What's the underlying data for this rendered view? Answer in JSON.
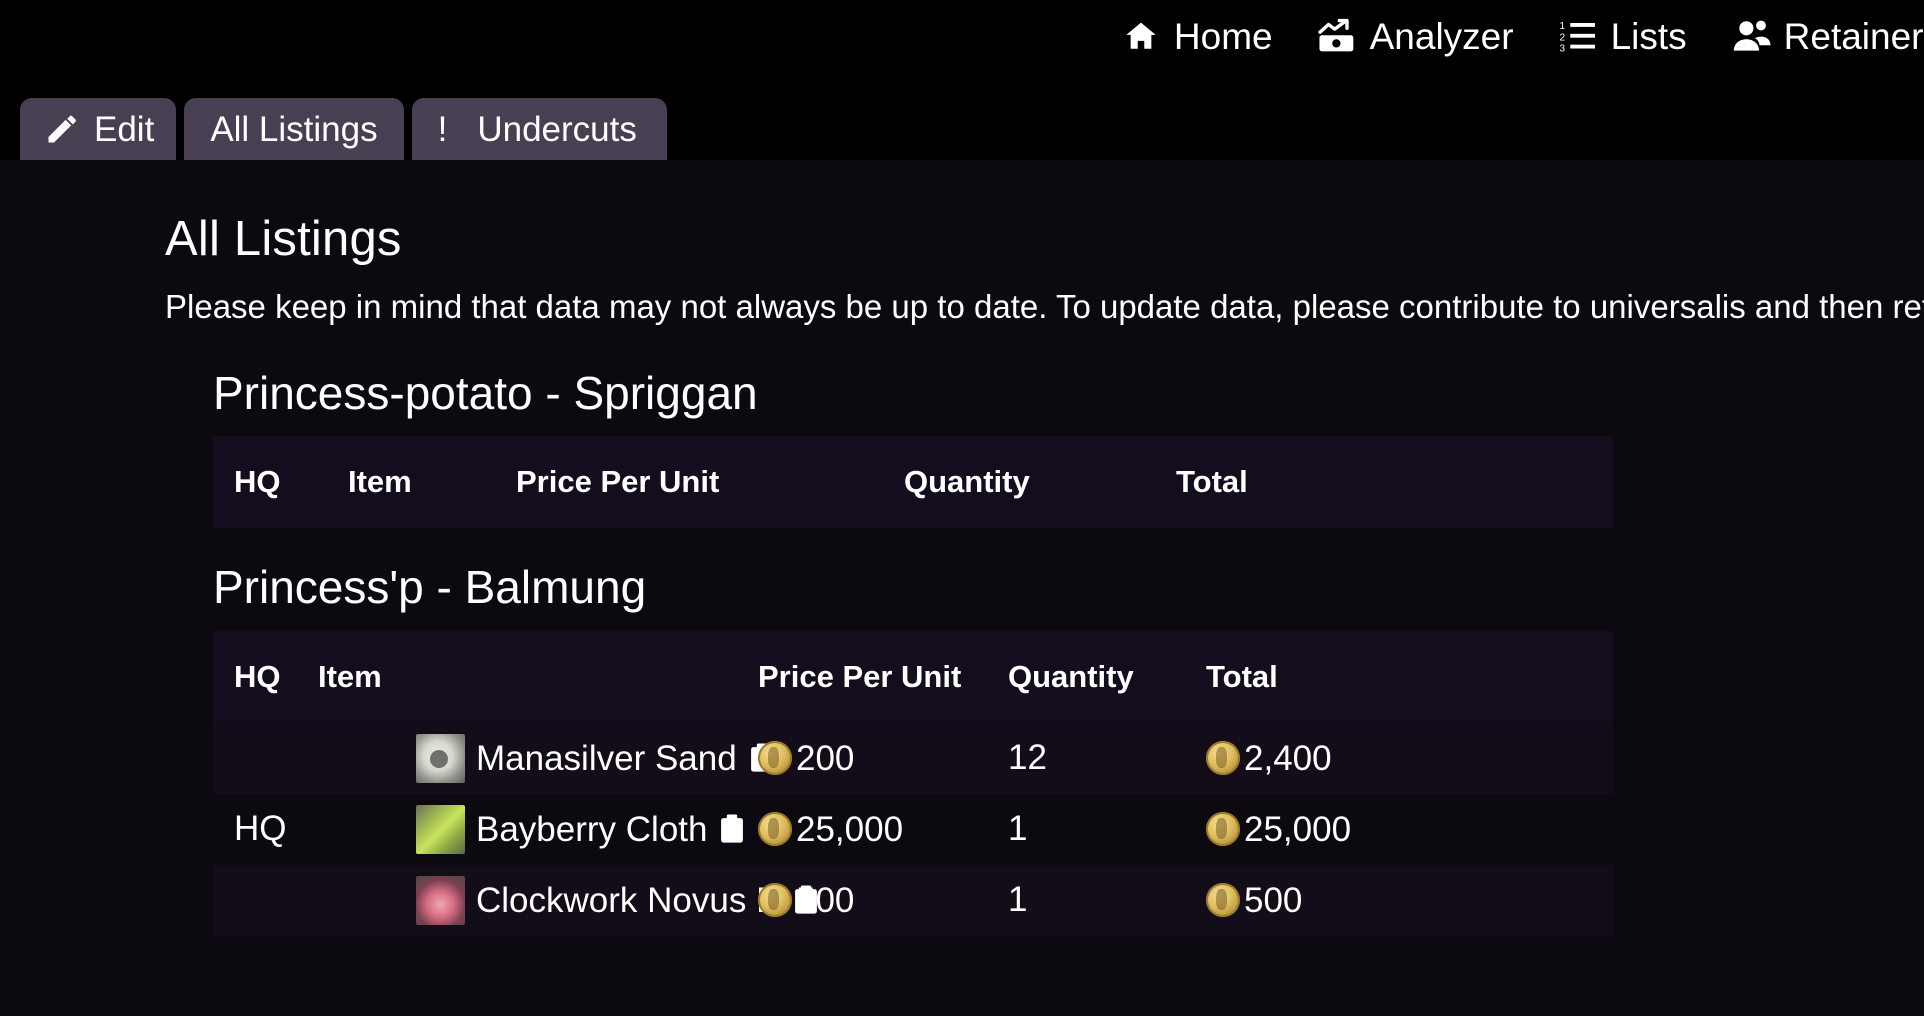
{
  "nav": {
    "items": [
      {
        "label": "Home",
        "icon": "home-icon"
      },
      {
        "label": "Analyzer",
        "icon": "analyzer-icon"
      },
      {
        "label": "Lists",
        "icon": "lists-icon"
      },
      {
        "label": "Retainers",
        "icon": "retainers-icon"
      }
    ]
  },
  "tabs": [
    {
      "label": "Edit",
      "icon": "pencil-icon",
      "active": false
    },
    {
      "label": "All Listings",
      "icon": "",
      "active": true
    },
    {
      "label": "Undercuts",
      "icon": "exclamation-icon",
      "badge": "!",
      "active": false
    }
  ],
  "page": {
    "title": "All Listings",
    "description": "Please keep in mind that data may not always be up to date. To update data, please contribute to universalis and then ref"
  },
  "columns": [
    "HQ",
    "Item",
    "Price Per Unit",
    "Quantity",
    "Total"
  ],
  "sections": [
    {
      "title": "Princess-potato - Spriggan",
      "rows": []
    },
    {
      "title": "Princess'p - Balmung",
      "rows": [
        {
          "hq": "",
          "item": "Manasilver Sand",
          "thumb": "thumb-sand",
          "price_per_unit": "200",
          "quantity": "12",
          "total": "2,400"
        },
        {
          "hq": "HQ",
          "item": "Bayberry Cloth",
          "thumb": "thumb-cloth",
          "price_per_unit": "25,000",
          "quantity": "1",
          "total": "25,000"
        },
        {
          "hq": "",
          "item": "Clockwork Novus D",
          "thumb": "thumb-clock",
          "price_per_unit": "500",
          "quantity": "1",
          "total": "500"
        }
      ]
    }
  ],
  "colors": {
    "background": "#000000",
    "page_background": "#0c0910",
    "tab": "#493f52",
    "table_header": "#130d1e",
    "row_alt": "#120d19",
    "text": "#ffffff",
    "gil_gold": "#e0bf61"
  }
}
